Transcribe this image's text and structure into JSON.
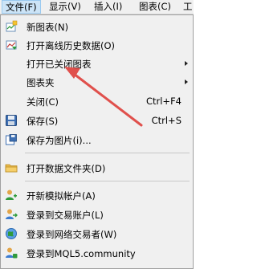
{
  "menubar": {
    "items": [
      {
        "label": "文件(F)"
      },
      {
        "label": "显示(V)"
      },
      {
        "label": "插入(I)"
      },
      {
        "label": "图表(C)"
      },
      {
        "label": "工"
      }
    ]
  },
  "file_menu": {
    "items": [
      {
        "label": "新图表(N)",
        "icon": "new-chart-icon"
      },
      {
        "label": "打开离线历史数据(O)",
        "icon": "open-offline-icon"
      },
      {
        "label": "打开已关闭图表"
      },
      {
        "label": "图表夹"
      },
      {
        "label": "关闭(C)",
        "shortcut": "Ctrl+F4"
      },
      {
        "label": "保存(S)",
        "shortcut": "Ctrl+S",
        "icon": "save-icon"
      },
      {
        "label": "保存为图片(i)...",
        "icon": "save-as-picture-icon"
      },
      {
        "label": "打开数据文件夹(D)",
        "icon": "folder-icon"
      },
      {
        "label": "开新模拟帐户(A)",
        "icon": "demo-account-icon"
      },
      {
        "label": "登录到交易账户(L)",
        "icon": "login-trade-icon"
      },
      {
        "label": "登录到网络交易者(W)",
        "icon": "web-trader-icon"
      },
      {
        "label": "登录到MQL5.community",
        "icon": "mql5-icon"
      }
    ]
  },
  "annotation": {
    "arrow_color": "#e0504c"
  }
}
